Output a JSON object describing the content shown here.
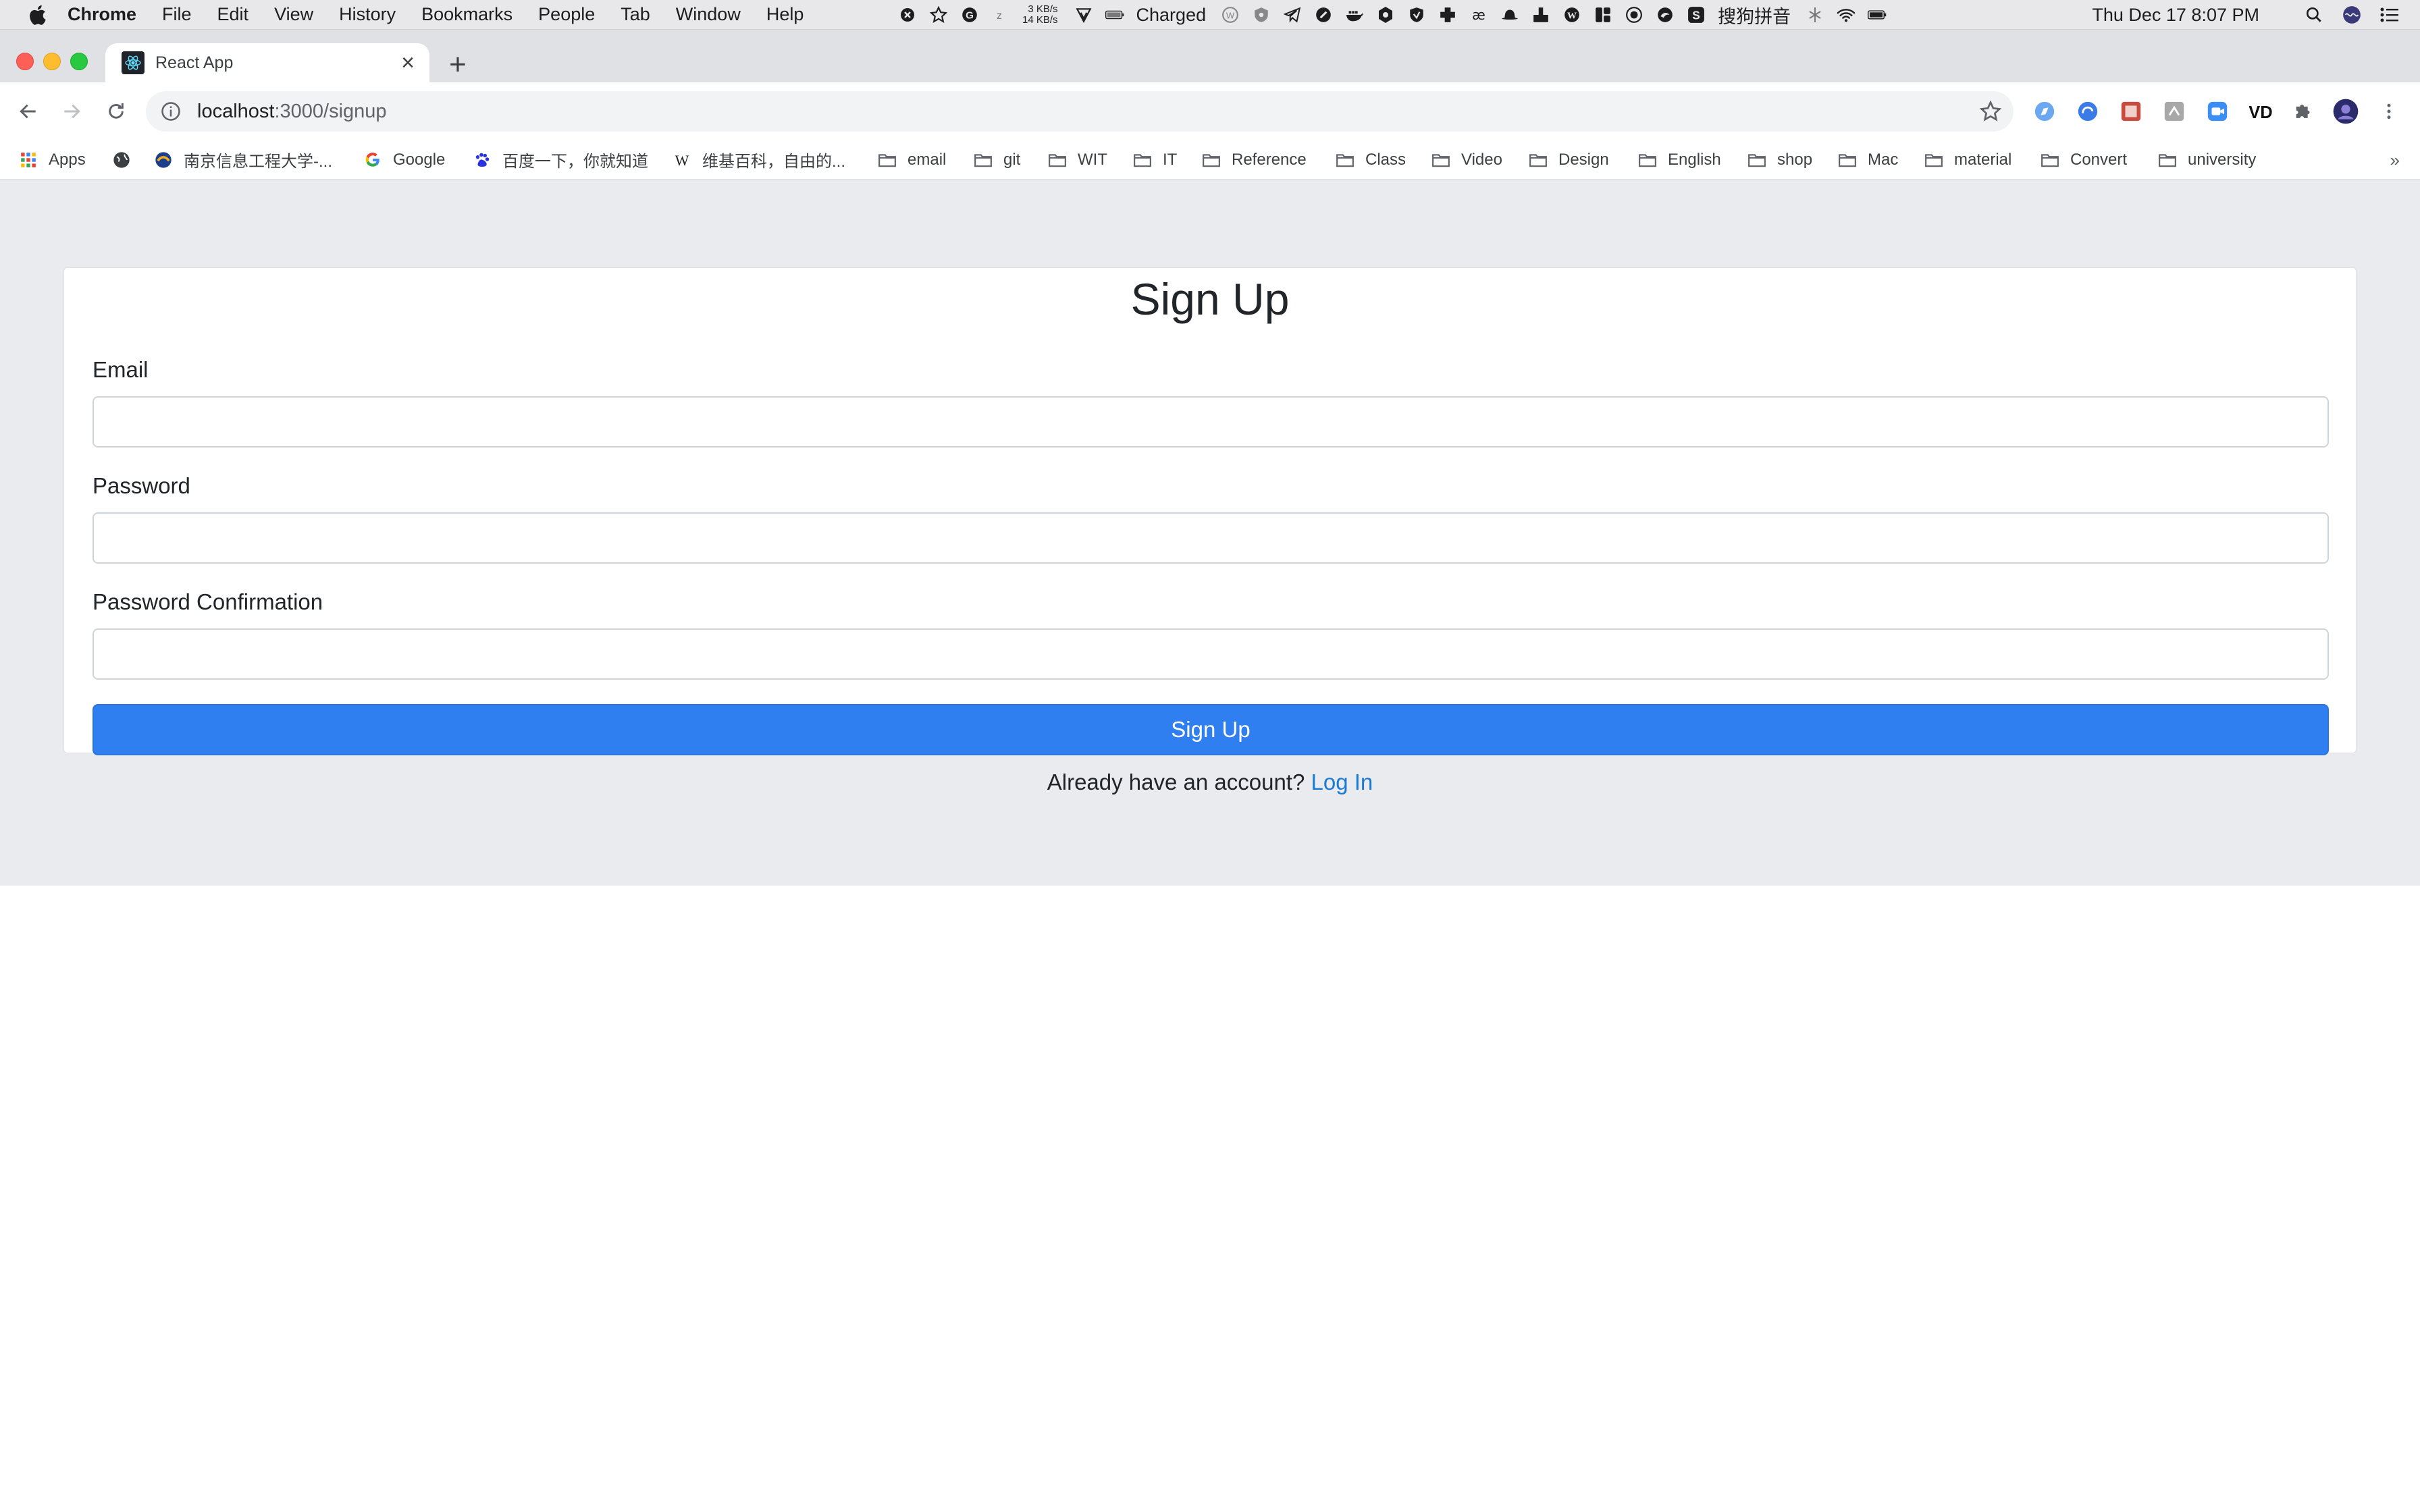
{
  "menubar": {
    "app_name": "Chrome",
    "items": [
      "File",
      "Edit",
      "View",
      "History",
      "Bookmarks",
      "People",
      "Tab",
      "Window",
      "Help"
    ],
    "net_up": "3 KB/s",
    "net_down": "14 KB/s",
    "battery_status": "Charged",
    "ime_label": "搜狗拼音",
    "datetime": "Thu Dec 17  8:07 PM"
  },
  "browser": {
    "tab_title": "React App",
    "url_host": "localhost",
    "url_path": ":3000/signup"
  },
  "bookmarks": [
    {
      "label": "Apps",
      "icon": "apps-grid-icon"
    },
    {
      "label": "",
      "icon": "globe-icon"
    },
    {
      "label": "南京信息工程大学-...",
      "icon": "university-logo-icon"
    },
    {
      "label": "Google",
      "icon": "google-icon"
    },
    {
      "label": "百度一下，你就知道",
      "icon": "baidu-icon"
    },
    {
      "label": "维基百科，自由的...",
      "icon": "wikipedia-icon"
    },
    {
      "label": "email",
      "icon": "folder-icon"
    },
    {
      "label": "git",
      "icon": "folder-icon"
    },
    {
      "label": "WIT",
      "icon": "folder-icon"
    },
    {
      "label": "IT",
      "icon": "folder-icon"
    },
    {
      "label": "Reference",
      "icon": "folder-icon"
    },
    {
      "label": "Class",
      "icon": "folder-icon"
    },
    {
      "label": "Video",
      "icon": "folder-icon"
    },
    {
      "label": "Design",
      "icon": "folder-icon"
    },
    {
      "label": "English",
      "icon": "folder-icon"
    },
    {
      "label": "shop",
      "icon": "folder-icon"
    },
    {
      "label": "Mac",
      "icon": "folder-icon"
    },
    {
      "label": "material",
      "icon": "folder-icon"
    },
    {
      "label": "Convert",
      "icon": "folder-icon"
    },
    {
      "label": "university",
      "icon": "folder-icon"
    }
  ],
  "bookmarks_overflow": "»",
  "form": {
    "title": "Sign Up",
    "email_label": "Email",
    "email_value": "",
    "password_label": "Password",
    "password_value": "",
    "password_confirm_label": "Password Confirmation",
    "password_confirm_value": "",
    "submit_label": "Sign Up",
    "login_prompt": "Already have an account?",
    "login_link": "Log In"
  },
  "colors": {
    "primary": "#2f7ff0",
    "link": "#1a7bd5",
    "page_background": "#e9ebee"
  }
}
